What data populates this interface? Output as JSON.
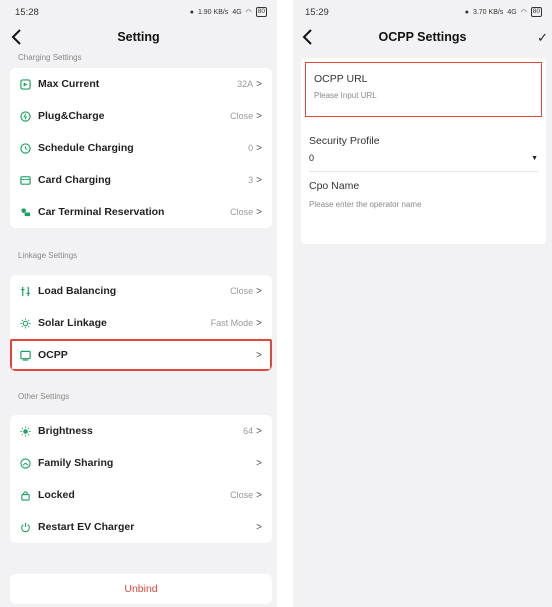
{
  "left": {
    "status": {
      "time": "15:28",
      "speed": "1.90 KB/s",
      "network": "4G",
      "battery": "80"
    },
    "header": {
      "title": "Setting"
    },
    "sections": [
      {
        "label": "Charging Settings",
        "items": [
          {
            "label": "Max Current",
            "value": "32A",
            "icon": "ev-icon"
          },
          {
            "label": "Plug&Charge",
            "value": "Close",
            "icon": "plug-icon"
          },
          {
            "label": "Schedule Charging",
            "value": "0",
            "icon": "clock-icon"
          },
          {
            "label": "Card Charging",
            "value": "3",
            "icon": "card-icon"
          },
          {
            "label": "Car Terminal Reservation",
            "value": "Close",
            "icon": "car-icon"
          }
        ]
      },
      {
        "label": "Linkage Settings",
        "items": [
          {
            "label": "Load Balancing",
            "value": "Close",
            "icon": "balance-icon"
          },
          {
            "label": "Solar Linkage",
            "value": "Fast Mode",
            "icon": "sun-icon"
          },
          {
            "label": "OCPP",
            "value": "",
            "icon": "monitor-icon"
          }
        ]
      },
      {
        "label": "Other Settings",
        "items": [
          {
            "label": "Brightness",
            "value": "64",
            "icon": "brightness-icon"
          },
          {
            "label": "Family Sharing",
            "value": "",
            "icon": "family-icon"
          },
          {
            "label": "Locked",
            "value": "Close",
            "icon": "lock-icon"
          },
          {
            "label": "Restart EV Charger",
            "value": "",
            "icon": "power-icon"
          }
        ]
      }
    ],
    "unbind_label": "Unbind",
    "chevron": ">"
  },
  "right": {
    "status": {
      "time": "15:29",
      "speed": "3.70 KB/s",
      "network": "4G",
      "battery": "80"
    },
    "header": {
      "title": "OCPP Settings"
    },
    "fields": {
      "url": {
        "label": "OCPP URL",
        "placeholder": "Please Input URL"
      },
      "security": {
        "label": "Security Profile",
        "value": "0"
      },
      "cpo": {
        "label": "Cpo Name",
        "placeholder": "Please enter the operator name"
      }
    }
  },
  "colors": {
    "accent_green": "#1aa260",
    "highlight_red": "#e0463a",
    "background": "#f2f2f4"
  }
}
